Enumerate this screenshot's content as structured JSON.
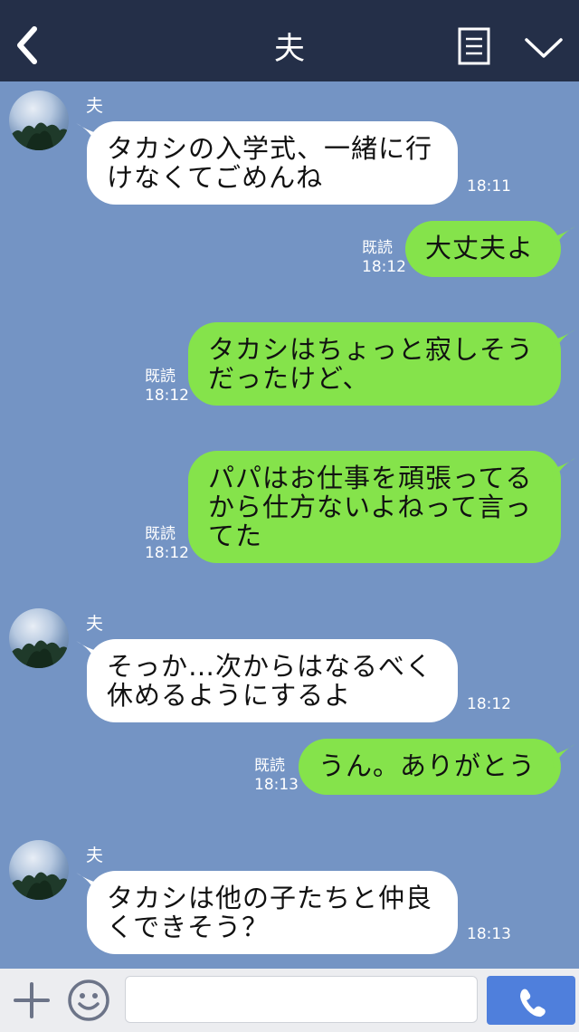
{
  "header": {
    "title": "夫",
    "colors": {
      "background": "#242f48"
    }
  },
  "chat": {
    "background": "#7494c4",
    "messages": [
      {
        "side": "in",
        "sender": "夫",
        "text": "タカシの入学式、一緒に行\nけなくてごめんね",
        "time": "18:11"
      },
      {
        "side": "out",
        "text": "大丈夫よ",
        "read": "既読",
        "time": "18:12"
      },
      {
        "side": "out",
        "text": "タカシはちょっと寂しそう\nだったけど、",
        "read": "既読",
        "time": "18:12"
      },
      {
        "side": "out",
        "text": "パパはお仕事を頑張ってる\nから仕方ないよねって言っ\nてた",
        "read": "既読",
        "time": "18:12"
      },
      {
        "side": "in",
        "sender": "夫",
        "text": "そっか…次からはなるべく\n休めるようにするよ",
        "time": "18:12"
      },
      {
        "side": "out",
        "text": "うん。ありがとう",
        "read": "既読",
        "time": "18:13"
      },
      {
        "side": "in",
        "sender": "夫",
        "text": "タカシは他の子たちと仲良\nくできそう？",
        "time": "18:13"
      }
    ],
    "colors": {
      "incoming": "#ffffff",
      "outgoing": "#85e34b"
    }
  },
  "footer": {
    "input_value": "",
    "icons": [
      "plus-icon",
      "emoji-icon",
      "phone-icon"
    ],
    "colors": {
      "call_button": "#4f7fdc"
    }
  }
}
